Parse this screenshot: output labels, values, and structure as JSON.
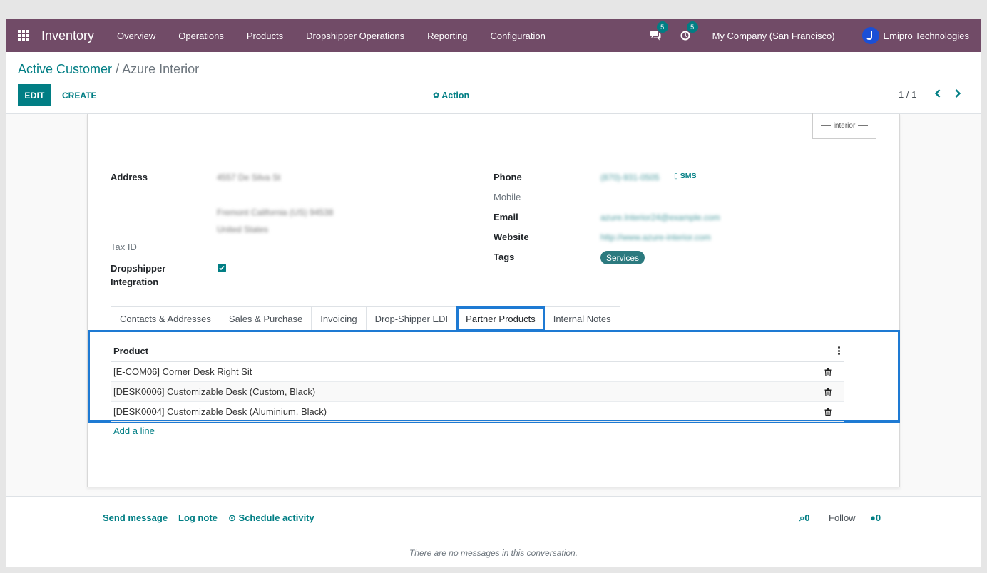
{
  "navbar": {
    "app_title": "Inventory",
    "menu": [
      "Overview",
      "Operations",
      "Products",
      "Dropshipper Operations",
      "Reporting",
      "Configuration"
    ],
    "messages_count": "5",
    "activities_count": "5",
    "company": "My Company (San Francisco)",
    "user": "Emipro Technologies"
  },
  "breadcrumb": {
    "parent": "Active Customer",
    "separator": "/",
    "current": "Azure Interior"
  },
  "buttons": {
    "edit": "EDIT",
    "create": "CREATE",
    "action": "Action"
  },
  "pager": {
    "value": "1 / 1"
  },
  "logo": {
    "text": "interior"
  },
  "fields": {
    "address_label": "Address",
    "address_line1": "4557 De Silva St",
    "address_line2": "Fremont  California (US)  94538",
    "address_line3": "United States",
    "tax_id_label": "Tax ID",
    "dropshipper_label_1": "Dropshipper",
    "dropshipper_label_2": "Integration",
    "dropshipper_checked": true,
    "phone_label": "Phone",
    "phone_value": "(870)-931-0505",
    "sms_label": "SMS",
    "mobile_label": "Mobile",
    "email_label": "Email",
    "email_value": "azure.Interior24@example.com",
    "website_label": "Website",
    "website_value": "http://www.azure-interior.com",
    "tags_label": "Tags",
    "tags": [
      "Services"
    ]
  },
  "tabs": [
    {
      "label": "Contacts & Addresses",
      "active": false
    },
    {
      "label": "Sales & Purchase",
      "active": false
    },
    {
      "label": "Invoicing",
      "active": false
    },
    {
      "label": "Drop-Shipper EDI",
      "active": false
    },
    {
      "label": "Partner Products",
      "active": true
    },
    {
      "label": "Internal Notes",
      "active": false
    }
  ],
  "partner_products": {
    "column_header": "Product",
    "rows": [
      "[E-COM06] Corner Desk Right Sit",
      "[DESK0006] Customizable Desk (Custom, Black)",
      "[DESK0004] Customizable Desk (Aluminium, Black)"
    ],
    "add_line": "Add a line"
  },
  "chatter": {
    "send_message": "Send message",
    "log_note": "Log note",
    "schedule_activity": "Schedule activity",
    "attachments_count": "0",
    "follow": "Follow",
    "followers_count": "0",
    "empty_text": "There are no messages in this conversation."
  },
  "colors": {
    "navbar": "#714b67",
    "accent": "#017e84",
    "highlight": "#1e7ad3"
  }
}
